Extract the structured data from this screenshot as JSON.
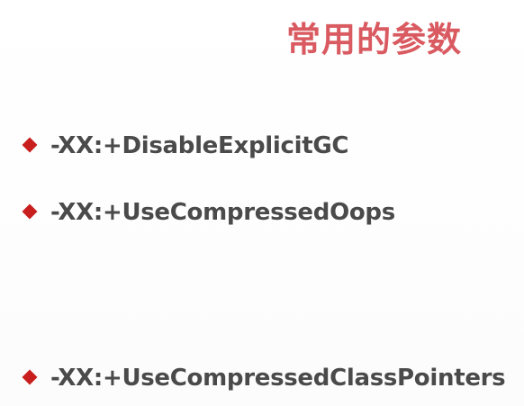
{
  "slide": {
    "title": "常用的参数",
    "bullets": [
      {
        "text": "-XX:+DisableExplicitGC"
      },
      {
        "text": "-XX:+UseCompressedOops"
      },
      {
        "text": "-XX:+UseCompressedClassPointers"
      }
    ]
  },
  "colors": {
    "title": "#d95a60",
    "bullet_marker": "#c81e1e",
    "bullet_text": "#4a4a4a",
    "background": "#ffffff"
  },
  "icons": {
    "bullet_marker": "diamond-bullet-icon"
  }
}
